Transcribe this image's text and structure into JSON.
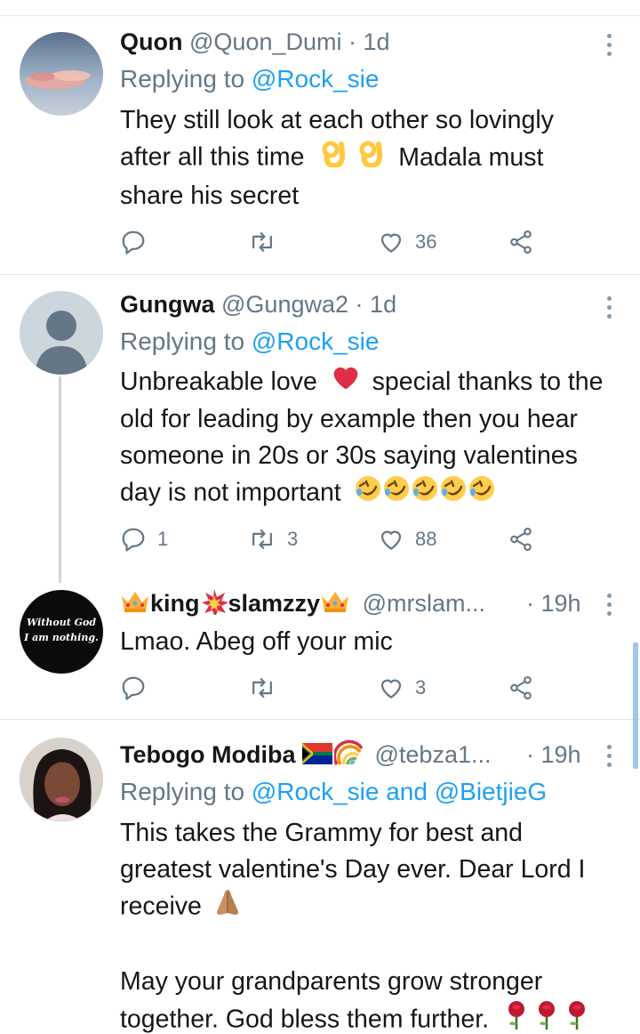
{
  "tweets": [
    {
      "name": "Quon",
      "handle": "@Quon_Dumi",
      "dot": "·",
      "time": "1d",
      "replying_prefix": "Replying to ",
      "replying_to": "@Rock_sie",
      "text_lines": [
        "They still look at each other so lovingly",
        "after all this time",
        "Madala must",
        "share his secret"
      ],
      "replies": "",
      "retweets": "",
      "likes": "36"
    },
    {
      "name": "Gungwa",
      "handle": "@Gungwa2",
      "dot": "·",
      "time": "1d",
      "replying_prefix": "Replying to ",
      "replying_to": "@Rock_sie",
      "text_lines": [
        "Unbreakable love",
        "special thanks to the",
        "old for leading by example then you hear",
        "someone in 20s or 30s saying valentines",
        "day is not important"
      ],
      "replies": "1",
      "retweets": "3",
      "likes": "88"
    },
    {
      "name_part1": "king",
      "name_part2": "slamzzy",
      "handle": "@mrslam...",
      "dot": "·",
      "time": "19h",
      "avatar_text_1": "Without God",
      "avatar_text_2": "I am nothing.",
      "text_lines": [
        "Lmao. Abeg off your mic"
      ],
      "replies": "",
      "retweets": "",
      "likes": "3"
    },
    {
      "name": "Tebogo Modiba",
      "handle": "@tebza1...",
      "dot": "·",
      "time": "19h",
      "replying_prefix": "Replying to ",
      "replying_to": "@Rock_sie and @BietjieG",
      "text_lines": [
        "This takes the Grammy for best and",
        "greatest valentine's Day ever. Dear Lord I",
        "receive",
        "",
        "May your grandparents grow stronger",
        "together. God bless them further."
      ]
    }
  ],
  "colors": {
    "link": "#1da1f2",
    "secondary_text": "#657786",
    "primary_text": "#14171a",
    "divider": "#e1e8ed"
  },
  "icons": [
    "reply-icon",
    "retweet-icon",
    "heart-icon",
    "share-icon",
    "more-icon"
  ]
}
